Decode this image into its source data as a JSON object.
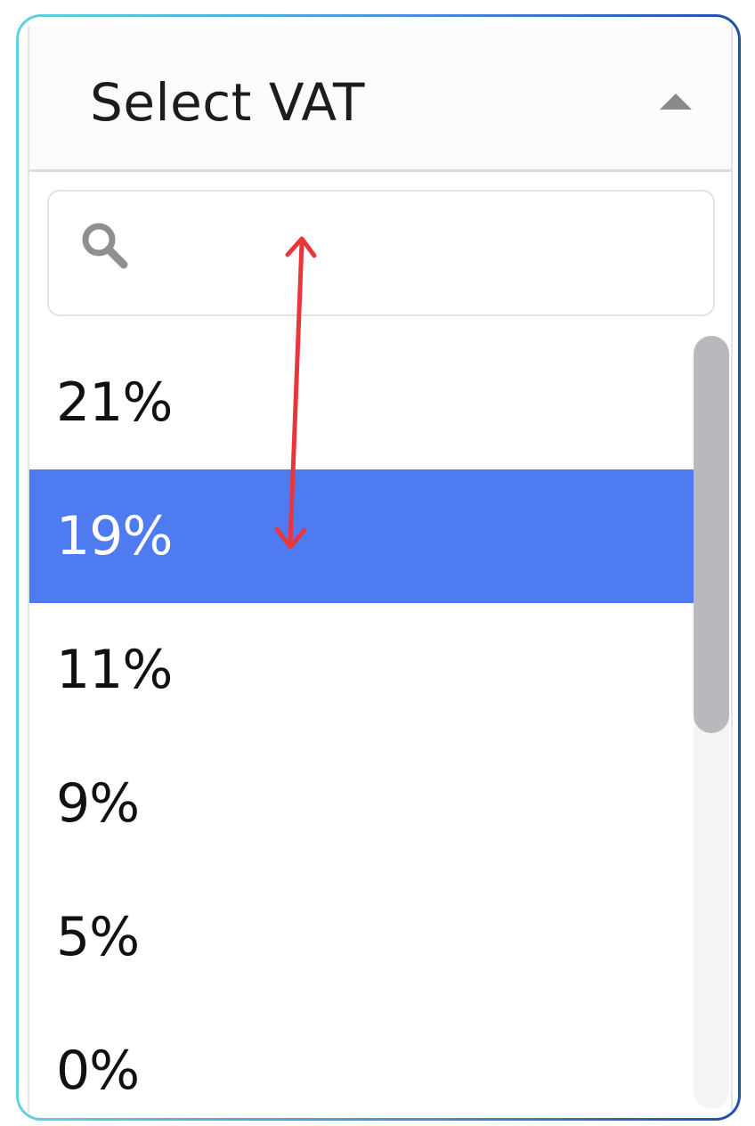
{
  "select": {
    "label": "Select VAT",
    "caret_icon": "caret-up-icon"
  },
  "search": {
    "icon": "search-icon",
    "value": "",
    "placeholder": ""
  },
  "options": [
    {
      "label": "21%",
      "selected": false
    },
    {
      "label": "19%",
      "selected": true
    },
    {
      "label": "11%",
      "selected": false
    },
    {
      "label": "9%",
      "selected": false
    },
    {
      "label": "5%",
      "selected": false
    },
    {
      "label": "0%",
      "selected": false
    }
  ],
  "scrollbar": {
    "position_fraction": 0.0,
    "visible_fraction": 0.51
  },
  "colors": {
    "selected_background": "#4e7cf0",
    "selected_text": "#ffffff",
    "border_gradient_start": "#5fd3df",
    "border_gradient_end": "#1f4fb0",
    "annotation_arrow": "#e8363c",
    "scrollbar_thumb": "#b9b9bd"
  },
  "annotation": {
    "type": "double-headed-arrow",
    "icon": "double-arrow-icon"
  }
}
